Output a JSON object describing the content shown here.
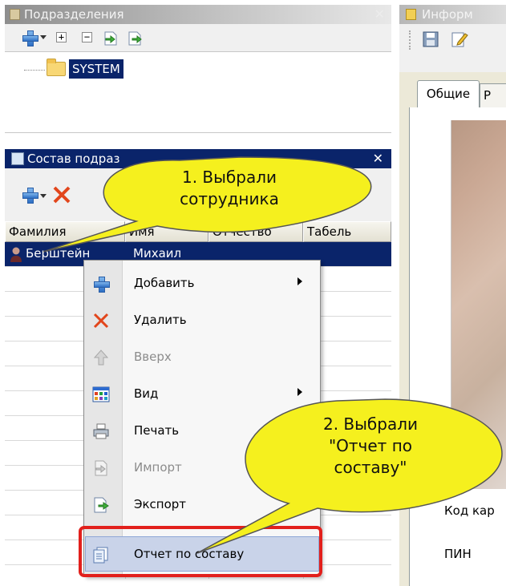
{
  "top_panel": {
    "title": "Подразделения",
    "tree": {
      "node": "SYSTEM"
    }
  },
  "mid_panel": {
    "title": "Состав подраз",
    "columns": [
      "Фамилия",
      "Имя",
      "Отчество",
      "Табель"
    ],
    "selected_row": {
      "surname": "Берштейн",
      "name": "Михаил"
    }
  },
  "right_panel": {
    "title": "Информ",
    "tabs": [
      "Общие",
      "Р"
    ],
    "label_card": "Код кар",
    "label_pin": "ПИН"
  },
  "context_menu": {
    "items": [
      {
        "label": "Добавить",
        "icon": "plus-icon",
        "enabled": true,
        "submenu": true
      },
      {
        "label": "Удалить",
        "icon": "delete-x-icon",
        "enabled": true,
        "submenu": false
      },
      {
        "label": "Вверх",
        "icon": "up-arrow-icon",
        "enabled": false,
        "submenu": false
      },
      {
        "label": "Вид",
        "icon": "view-grid-icon",
        "enabled": true,
        "submenu": true
      },
      {
        "label": "Печать",
        "icon": "printer-icon",
        "enabled": true,
        "submenu": false
      },
      {
        "label": "Импорт",
        "icon": "import-icon",
        "enabled": false,
        "submenu": false
      },
      {
        "label": "Экспорт",
        "icon": "export-icon",
        "enabled": true,
        "submenu": false
      },
      {
        "label": "Отчет по составу",
        "icon": "report-icon",
        "enabled": true,
        "submenu": false,
        "highlighted": true
      }
    ]
  },
  "callouts": {
    "first": [
      "1. Выбрали",
      "сотрудника"
    ],
    "second": [
      "2. Выбрали",
      "\"Отчет по",
      "составу\""
    ]
  },
  "colors": {
    "selection": "#0a246a",
    "callout_fill": "#f5f01e",
    "highlight_border": "#e2201c"
  }
}
